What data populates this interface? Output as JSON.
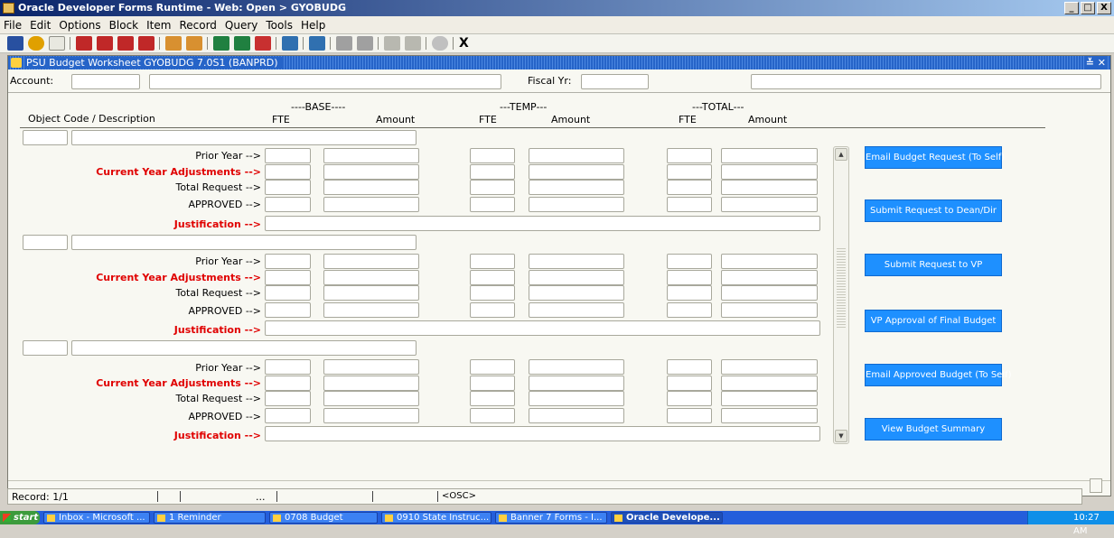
{
  "window": {
    "title": "Oracle Developer Forms Runtime - Web:  Open > GYOBUDG",
    "controls": [
      "_",
      "□",
      "X"
    ]
  },
  "menu": [
    "File",
    "Edit",
    "Options",
    "Block",
    "Item",
    "Record",
    "Query",
    "Tools",
    "Help"
  ],
  "toolbar": {
    "icons": [
      "save-icon",
      "rollback-icon",
      "print-icon",
      "previous-block-icon",
      "next-block-icon",
      "previous-record-icon",
      "next-record-icon",
      "enter-query-icon",
      "execute-query-icon",
      "insert-record-icon",
      "remove-record-icon",
      "clear-record-icon",
      "print-icon",
      "copy-icon",
      "paste-icon",
      "help-icon",
      "search-icon",
      "about-icon"
    ],
    "exit_label": "X"
  },
  "form": {
    "title": "PSU Budget Worksheet  GYOBUDG  7.0S1  (BANPRD)",
    "title_controls": "≚ ✕",
    "header": {
      "account_label": "Account:",
      "fiscal_label": "Fiscal Yr:"
    },
    "columns": {
      "base_group": "----BASE----",
      "temp_group": "---TEMP---",
      "total_group": "---TOTAL---",
      "object_code": "Object Code / Description",
      "fte": "FTE",
      "amount": "Amount"
    },
    "row_labels": {
      "prior": "Prior Year -->",
      "current": "Current Year Adjustments -->",
      "total": "Total Request -->",
      "approved": "APPROVED -->",
      "justification": "Justification -->"
    },
    "buttons": [
      "Email Budget Request (To Self)",
      "Submit Request to Dean/Dir",
      "Submit Request to VP",
      "VP Approval of Final Budget",
      "Email Approved Budget (To Self)",
      "View Budget Summary"
    ],
    "colors": {
      "button_bg": "#1e90ff",
      "required_label": "#e00000",
      "form_title": "#2664c8"
    }
  },
  "status": {
    "record": "Record: 1/1",
    "dots": "...",
    "mode": "<OSC>"
  },
  "taskbar": {
    "start": "start",
    "tasks": [
      "Inbox - Microsoft ...",
      "1 Reminder",
      "0708 Budget",
      "0910 State Instruc...",
      "Banner 7 Forms - I...",
      "Oracle Develope..."
    ],
    "clock": "10:27 AM"
  }
}
